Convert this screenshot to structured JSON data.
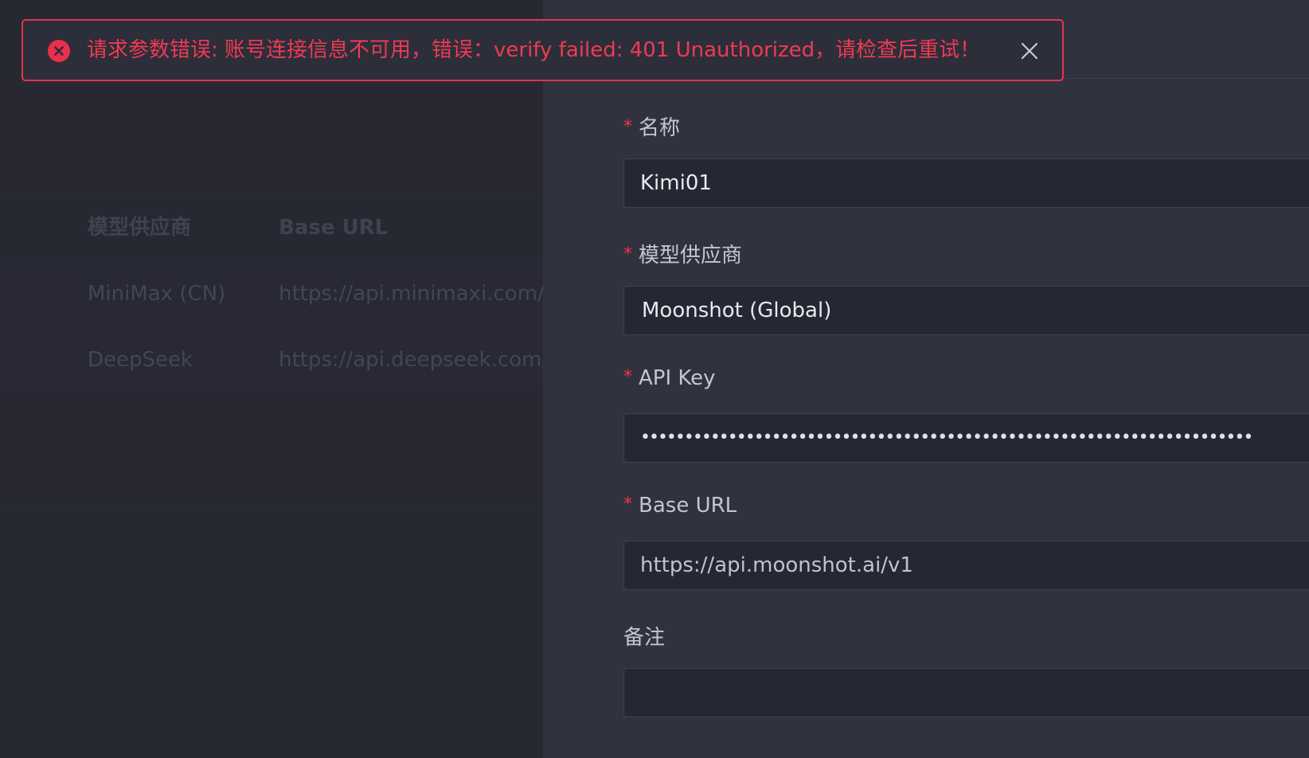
{
  "toast": {
    "icon": "error-circle-icon",
    "message": "请求参数错误: 账号连接信息不可用，错误：verify failed: 401 Unauthorized，请检查后重试！",
    "close_icon": "close-icon",
    "color": "#e8324c"
  },
  "background_list": {
    "columns": [
      "模型供应商",
      "Base URL"
    ],
    "rows": [
      [
        "MiniMax (CN)",
        "https://api.minimaxi.com/ar"
      ],
      [
        "DeepSeek",
        "https://api.deepseek.com/v"
      ]
    ]
  },
  "form": {
    "name": {
      "label": "名称",
      "required_mark": "*",
      "value": "Kimi01"
    },
    "provider": {
      "label": "模型供应商",
      "required_mark": "*",
      "value": "Moonshot (Global)"
    },
    "api_key": {
      "label": "API Key",
      "required_mark": "*",
      "value": "••••••••••••••••••••••••••••••••••••••••••••••••••••••••••••••••••••••"
    },
    "base_url": {
      "label": "Base URL",
      "required_mark": "*",
      "value": "https://api.moonshot.ai/v1"
    },
    "notes": {
      "label": "备注",
      "value": ""
    }
  },
  "colors": {
    "required": "#f0334f",
    "error": "#e8324c",
    "drawer_bg": "#30323f",
    "input_bg": "#252733"
  }
}
